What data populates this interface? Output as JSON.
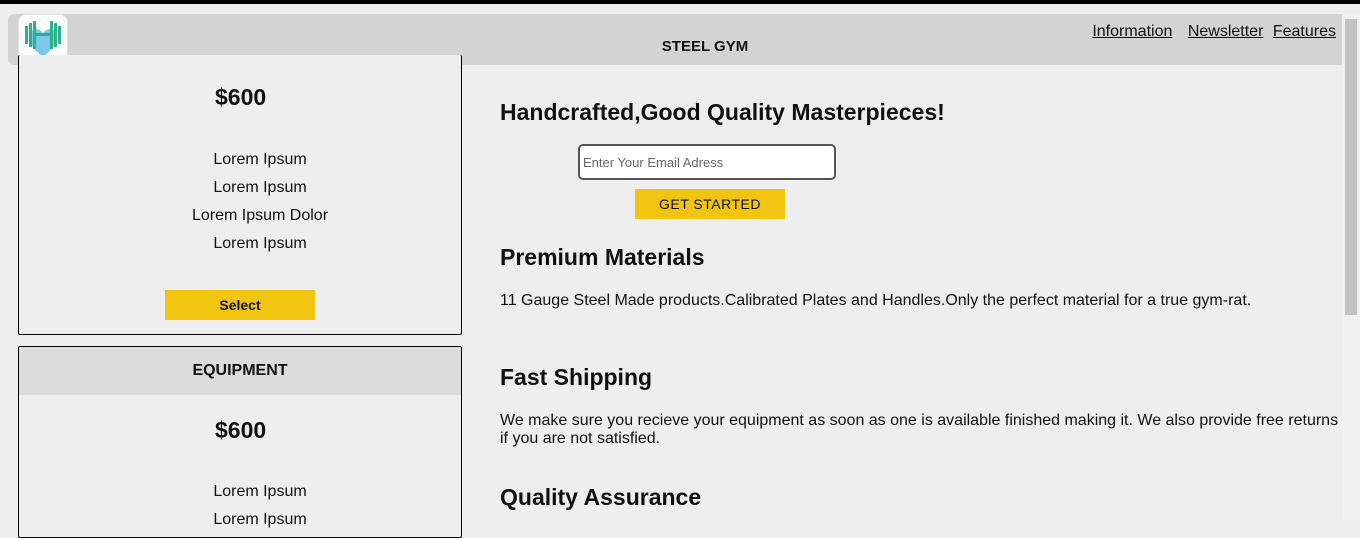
{
  "header": {
    "brand": "STEEL GYM",
    "nav": [
      "Information",
      "Newsletter",
      "Features"
    ]
  },
  "cards": [
    {
      "title": "",
      "price": "$600",
      "features": [
        "Lorem Ipsum",
        "Lorem Ipsum",
        "Lorem Ipsum Dolor",
        "Lorem Ipsum"
      ],
      "button": "Select"
    },
    {
      "title": "EQUIPMENT",
      "price": "$600",
      "features": [
        "Lorem Ipsum",
        "Lorem Ipsum"
      ]
    }
  ],
  "hero": {
    "title": "Handcrafted,Good Quality Masterpieces!",
    "email_placeholder": "Enter Your Email Adress",
    "cta": "GET STARTED"
  },
  "sections": [
    {
      "title": "Premium Materials",
      "text": "11 Gauge Steel Made products.Calibrated Plates and Handles.Only the perfect material for a true gym-rat."
    },
    {
      "title": "Fast Shipping",
      "text": "We make sure you recieve your equipment as soon as one is available finished making it. We also provide free returns if you are not satisfied."
    },
    {
      "title": "Quality Assurance"
    }
  ],
  "colors": {
    "accent": "#f1c40f",
    "header": "#d3d3d3",
    "background": "#eeeeee",
    "logo_teal": "#2bb28b",
    "logo_blue": "#7cc8ea"
  },
  "icons": {
    "logo": "dumbbell-heart-logo"
  }
}
